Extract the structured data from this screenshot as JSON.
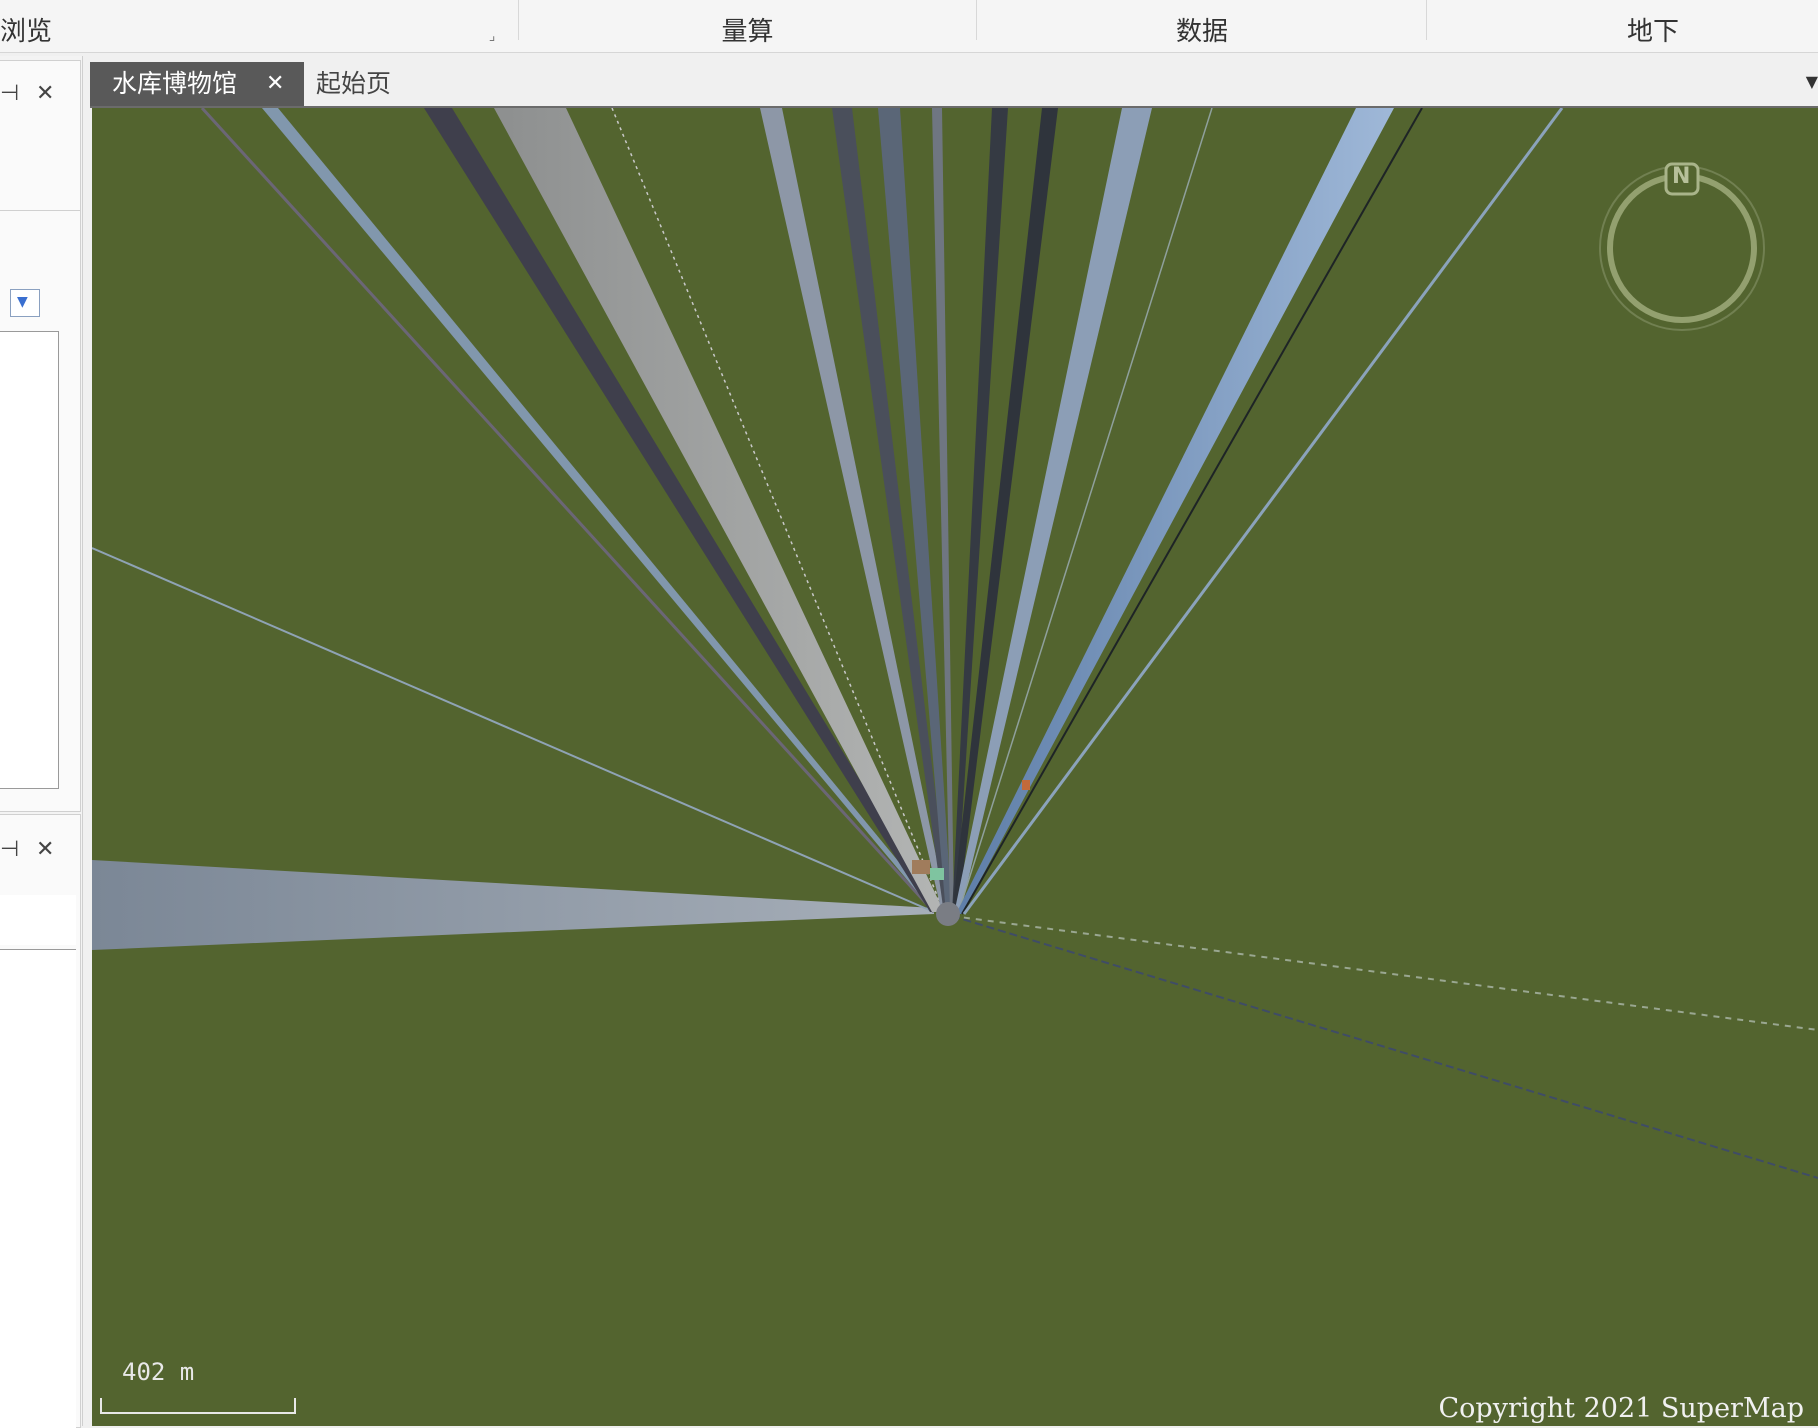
{
  "ribbon": {
    "groups": [
      {
        "label": "浏览"
      },
      {
        "label": "量算"
      },
      {
        "label": "数据"
      },
      {
        "label": "地下"
      }
    ]
  },
  "left_dock": {
    "panel1": {
      "pin_icon": "pin-icon",
      "close_label": "✕"
    },
    "panel2": {
      "pin_icon": "pin-icon",
      "close_label": "✕"
    }
  },
  "tabs": [
    {
      "label": "水库博物馆",
      "active": true,
      "close_label": "✕"
    },
    {
      "label": "起始页",
      "active": false
    }
  ],
  "scene": {
    "scale_label": "402 m",
    "copyright": "Copyright 2021 SuperMap",
    "compass_label": "N",
    "background_color": "#53642f"
  }
}
